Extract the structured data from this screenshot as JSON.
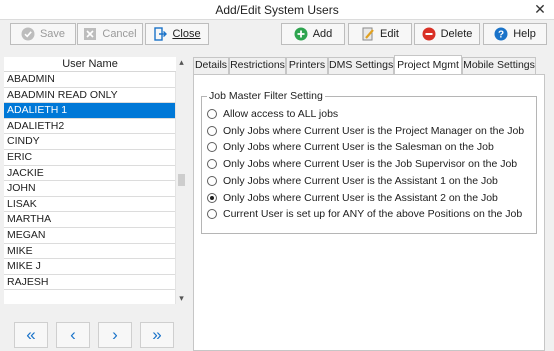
{
  "window": {
    "title": "Add/Edit System Users"
  },
  "toolbar": {
    "save_label": "Save",
    "cancel_label": "Cancel",
    "close_label": "Close",
    "add_label": "Add",
    "edit_label": "Edit",
    "delete_label": "Delete",
    "help_label": "Help"
  },
  "user_list": {
    "header": "User Name",
    "items": [
      "ABADMIN",
      "ABADMIN READ ONLY",
      "ADALIETH 1",
      "ADALIETH2",
      "CINDY",
      "ERIC",
      "JACKIE",
      "JOHN",
      "LISAK",
      "MARTHA",
      "MEGAN",
      "MIKE",
      "MIKE J",
      "RAJESH"
    ],
    "selected": "ADALIETH 1"
  },
  "nav": {
    "first": "«",
    "prev": "‹",
    "next": "›",
    "last": "»"
  },
  "tabs": [
    "Details",
    "Restrictions",
    "Printers",
    "DMS Settings",
    "Project Mgmt",
    "Mobile Settings"
  ],
  "active_tab": "Project Mgmt",
  "job_filter": {
    "legend": "Job Master Filter Setting",
    "options": [
      "Allow access to ALL jobs",
      "Only Jobs where Current User is the Project Manager on the Job",
      "Only Jobs where Current User is the Salesman on the Job",
      "Only Jobs where Current User is the Job Supervisor on the Job",
      "Only Jobs where Current User is the Assistant 1 on the Job",
      "Only Jobs where Current User is the Assistant 2 on the Job",
      "Current User is set up for ANY of the above Positions on the Job"
    ],
    "selected_index": 5
  },
  "colors": {
    "selection": "#0078d7",
    "add": "#2ea44f",
    "delete": "#d93025",
    "help": "#1a73c9",
    "nav": "#1a73c9"
  },
  "icons": {
    "save": "check-circle-icon",
    "cancel": "x-box-icon",
    "close": "exit-door-icon",
    "add": "plus-circle-icon",
    "edit": "edit-document-icon",
    "delete": "minus-circle-icon",
    "help": "question-circle-icon"
  }
}
